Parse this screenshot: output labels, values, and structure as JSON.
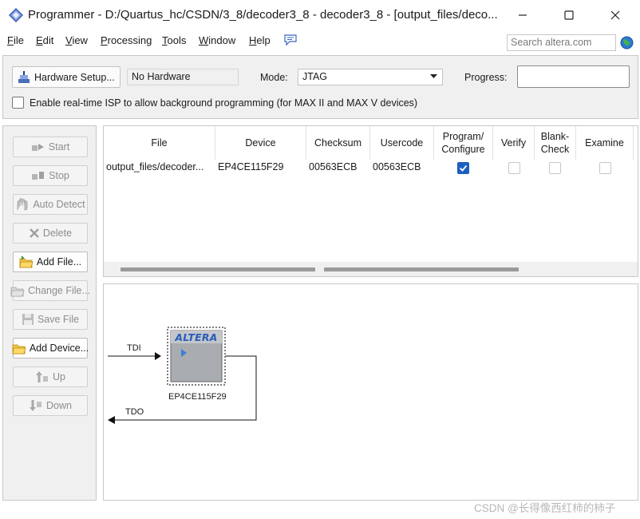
{
  "window": {
    "title": "Programmer - D:/Quartus_hc/CSDN/3_8/decoder3_8 - decoder3_8 - [output_files/deco...",
    "controls": [
      "minimize",
      "maximize",
      "close"
    ]
  },
  "menu": {
    "items": [
      {
        "mnemonic": "F",
        "rest": "ile"
      },
      {
        "mnemonic": "E",
        "rest": "dit"
      },
      {
        "mnemonic": "V",
        "rest": "iew"
      },
      {
        "mnemonic": "P",
        "rest": "rocessing"
      },
      {
        "mnemonic": "T",
        "rest": "ools"
      },
      {
        "mnemonic": "W",
        "rest": "indow"
      },
      {
        "mnemonic": "H",
        "rest": "elp"
      }
    ],
    "search_placeholder": "Search altera.com"
  },
  "toolbar": {
    "hardware_setup_label": "Hardware Setup...",
    "hardware_value": "No Hardware",
    "mode_label": "Mode:",
    "mode_value": "JTAG",
    "progress_label": "Progress:",
    "progress_value": 0,
    "isp_label": "Enable real-time ISP to allow background programming (for MAX II and MAX V devices)",
    "isp_checked": false
  },
  "sidebar": {
    "buttons": [
      {
        "label": "Start",
        "icon": "start-icon",
        "enabled": false
      },
      {
        "label": "Stop",
        "icon": "stop-icon",
        "enabled": false
      },
      {
        "label": "Auto Detect",
        "icon": "auto-detect-icon",
        "enabled": false
      },
      {
        "label": "Delete",
        "icon": "delete-x-icon",
        "enabled": false
      },
      {
        "label": "Add File...",
        "icon": "add-file-icon",
        "enabled": true
      },
      {
        "label": "Change File...",
        "icon": "change-file-icon",
        "enabled": false
      },
      {
        "label": "Save File",
        "icon": "save-file-icon",
        "enabled": false
      },
      {
        "label": "Add Device...",
        "icon": "add-device-icon",
        "enabled": true
      },
      {
        "label": "Up",
        "icon": "up-arrow-icon",
        "enabled": false
      },
      {
        "label": "Down",
        "icon": "down-arrow-icon",
        "enabled": false
      }
    ]
  },
  "table": {
    "columns": [
      "File",
      "Device",
      "Checksum",
      "Usercode",
      "Program/\nConfigure",
      "Verify",
      "Blank-\nCheck",
      "Examine"
    ],
    "rows": [
      {
        "file": "output_files/decoder...",
        "device": "EP4CE115F29",
        "checksum": "00563ECB",
        "usercode": "00563ECB",
        "program_configure": true,
        "verify": false,
        "blank_check": false,
        "examine": false
      }
    ]
  },
  "chain": {
    "tdi_label": "TDI",
    "tdo_label": "TDO",
    "device_name": "EP4CE115F29",
    "chip_logo": "ALTERA"
  },
  "watermark": "CSDN @长得像西红柿的柿子"
}
